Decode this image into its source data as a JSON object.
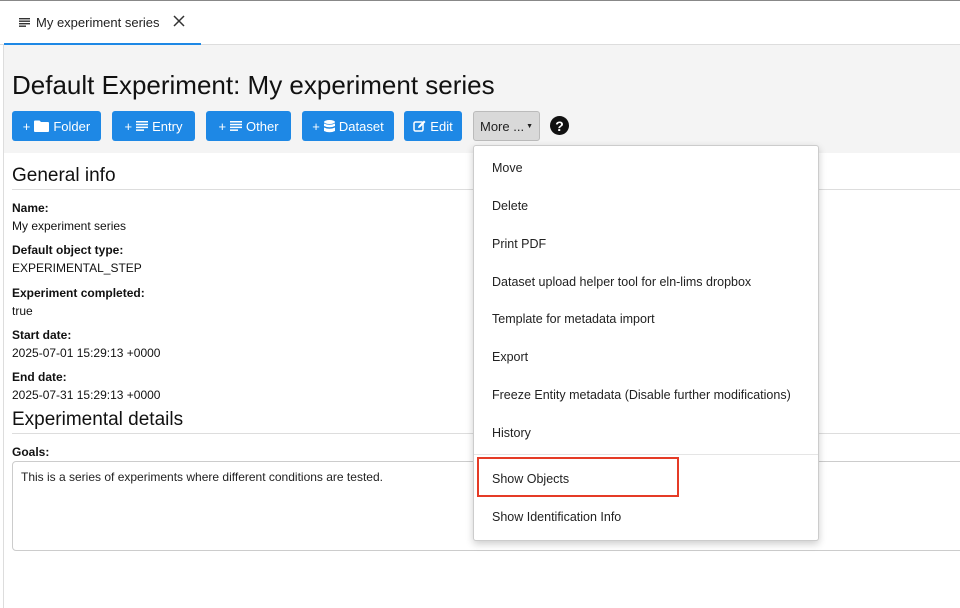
{
  "tab": {
    "title": "My experiment series",
    "icon": "list-icon",
    "close_icon": "close-icon"
  },
  "page_title": "Default Experiment: My experiment series",
  "toolbar": {
    "buttons": [
      {
        "label": "Folder",
        "icon": "folder-icon"
      },
      {
        "label": "Entry",
        "icon": "list-icon"
      },
      {
        "label": "Other",
        "icon": "list-icon"
      },
      {
        "label": "Dataset",
        "icon": "database-icon"
      },
      {
        "label": "Edit",
        "icon": "edit-icon"
      }
    ],
    "more_label": "More ...",
    "help_symbol": "?"
  },
  "general_info": {
    "title": "General info",
    "fields": [
      {
        "label": "Name:",
        "value": "My experiment series"
      },
      {
        "label": "Default object type:",
        "value": "EXPERIMENTAL_STEP"
      },
      {
        "label": "Experiment completed:",
        "value": "true"
      },
      {
        "label": "Start date:",
        "value": "2025-07-01 15:29:13 +0000"
      },
      {
        "label": "End date:",
        "value": "2025-07-31 15:29:13 +0000"
      }
    ]
  },
  "experimental_details": {
    "title": "Experimental details",
    "goals_label": "Goals:",
    "goals_text": "This is a series of experiments where different conditions are tested."
  },
  "more_menu": {
    "items": [
      "Move",
      "Delete",
      "Print PDF",
      "Dataset upload helper tool for eln-lims dropbox",
      "Template for metadata import",
      "Export",
      "Freeze Entity metadata (Disable further modifications)",
      "History",
      "Show Objects",
      "Show Identification Info"
    ],
    "highlighted": "Show Objects",
    "highlight_color": "#e53b26"
  },
  "colors": {
    "primary": "#1e88e5",
    "header_bg": "#f4f4f4"
  }
}
